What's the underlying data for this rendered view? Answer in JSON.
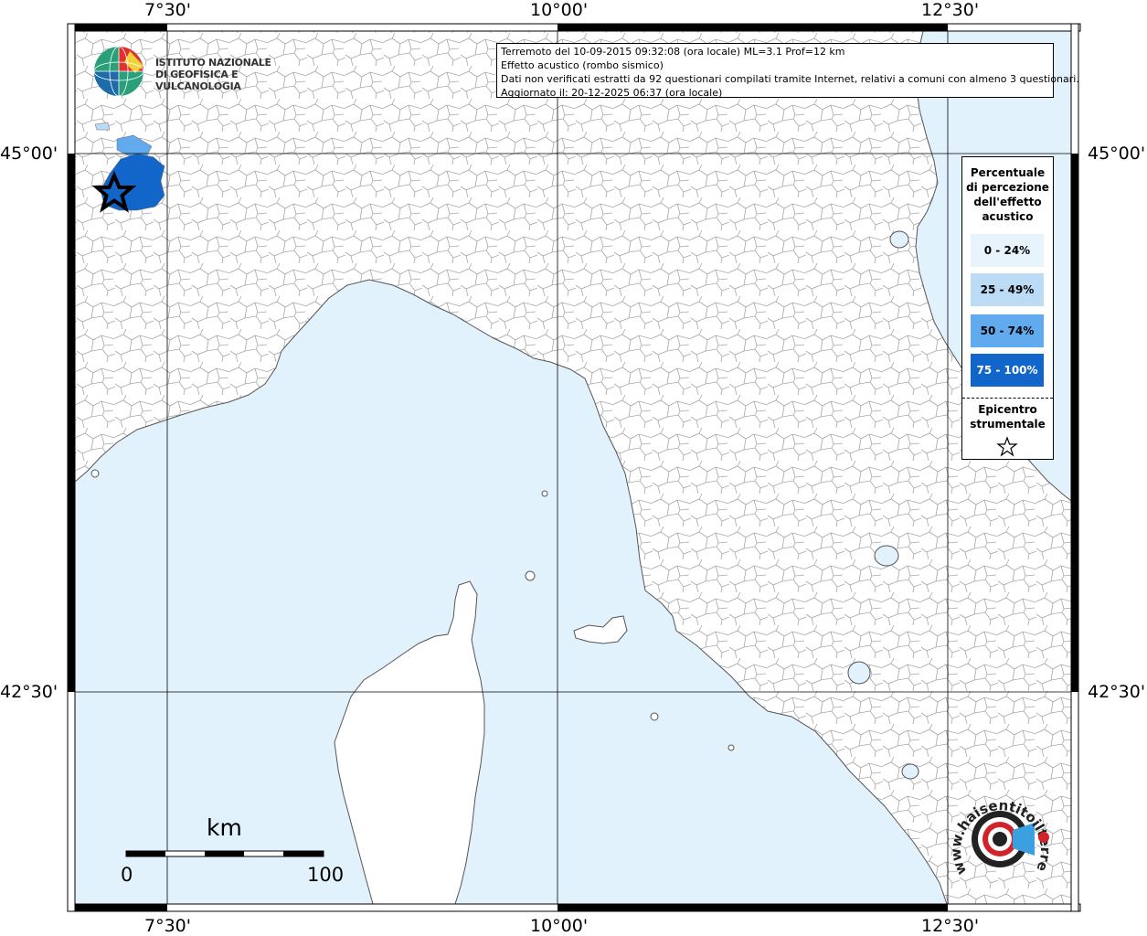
{
  "axes": {
    "lon_labels": [
      "7°30'",
      "10°00'",
      "12°30'"
    ],
    "lat_labels": [
      "45°00'",
      "42°30'"
    ]
  },
  "info_box": {
    "line1": "Terremoto del 10-09-2015 09:32:08 (ora locale) ML=3.1 Prof=12 km",
    "line2": "Effetto acustico (rombo sismico)",
    "line3": "Dati non verificati estratti da 92 questionari compilati tramite Internet, relativi a comuni con almeno 3 questionari.",
    "line4": "Aggiornato il: 20-12-2025 06:37 (ora locale)"
  },
  "legend": {
    "title_l1": "Percentuale",
    "title_l2": "di percezione",
    "title_l3": "dell'effetto",
    "title_l4": "acustico",
    "classes": [
      {
        "label": "0 - 24%",
        "color": "#e8f4fc",
        "text": "#000000"
      },
      {
        "label": "25 - 49%",
        "color": "#bcdcf6",
        "text": "#000000"
      },
      {
        "label": "50 - 74%",
        "color": "#62aaee",
        "text": "#000000"
      },
      {
        "label": "75 - 100%",
        "color": "#1366c9",
        "text": "#ffffff"
      }
    ],
    "epicenter_l1": "Epicentro",
    "epicenter_l2": "strumentale"
  },
  "logo_ingv": {
    "line1": "ISTITUTO NAZIONALE",
    "line2": "DI GEOFISICA E VULCANOLOGIA"
  },
  "scale_bar": {
    "unit": "km",
    "min_label": "0",
    "max_label": "100"
  },
  "logo_hsl": {
    "text": "www.haisentitoilterremoto.it"
  },
  "colors": {
    "sea": "#e2f2fc",
    "land": "#ffffff",
    "borders": "#9a9a9a",
    "frame": "#000000"
  }
}
